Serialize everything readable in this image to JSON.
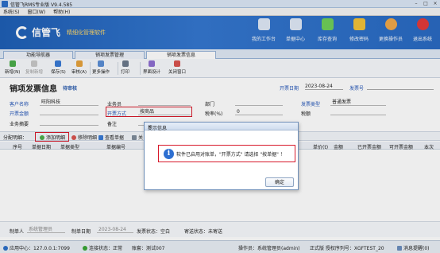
{
  "window": {
    "title": "信管飞RMS专业版 V9.4.585",
    "controls": [
      "–",
      "□",
      "×"
    ]
  },
  "menu": [
    "系统(S)",
    "窗口(W)",
    "帮助(H)"
  ],
  "brand": {
    "name": "信管飞",
    "slogan": "精细化管理软件"
  },
  "nav": [
    {
      "label": "我的工作台",
      "icon": "monitor-icon",
      "color": "#dfe9f7"
    },
    {
      "label": "单据中心",
      "icon": "document-center-icon",
      "color": "#dfe9f7"
    },
    {
      "label": "库存查询",
      "icon": "inventory-icon",
      "color": "#6fcf5a"
    },
    {
      "label": "修改密码",
      "icon": "lock-icon",
      "color": "#f2c23a"
    },
    {
      "label": "更换操作员",
      "icon": "user-icon",
      "color": "#f0a84a"
    },
    {
      "label": "退出系统",
      "icon": "exit-icon",
      "color": "#e23b3b"
    }
  ],
  "tabs": [
    "功能导航器",
    "销项发票管理",
    "销项发票信息"
  ],
  "toolbar": {
    "new": "新增(N)",
    "copy": "复制新增",
    "save": "保存(S)",
    "audit": "审核(A)",
    "more": "更多操作",
    "print": "打印",
    "layout": "界面设计",
    "close": "关闭窗口"
  },
  "form": {
    "title": "销项发票信息",
    "status": "待审核",
    "date_label": "开票日期",
    "date_value": "2023-08-24",
    "invoice_no_label": "发票号",
    "customer_label": "客户名称",
    "customer_value": "旺阳科技",
    "amount_label": "开票金额",
    "salesperson_label": "业务员",
    "method_label": "开票方式",
    "method_value": "按商品",
    "dept_label": "部门",
    "tax_label": "税率(%)",
    "tax_value": "0",
    "invtype_label": "发票类型",
    "invtype_value": "普通发票",
    "taxamt_label": "税额",
    "summary_label": "业务摘要",
    "remark_label": "备注"
  },
  "detail": {
    "label": "分配明细：",
    "add": "添加明细",
    "remove": "移除明细",
    "view": "查看单据",
    "close_btn": "关"
  },
  "grid": {
    "columns": [
      "序号",
      "单据日期",
      "单据类型",
      "单据编号",
      "单价(t)",
      "金额",
      "已开票金额",
      "可开票金额",
      "本次"
    ]
  },
  "footer": {
    "maker_label": "制单人",
    "maker_value": "系统管理员",
    "makedate_label": "制单日期",
    "makedate_value": "2023-08-24",
    "invstatus": "发票状态：空白",
    "mailstatus": "寄送状态：未寄送"
  },
  "statusbar": {
    "center": "应用中心：127.0.0.1:7099",
    "conn": "连接状态：正常",
    "account": "账套：测试007",
    "operator": "操作员：系统管理员(admin)",
    "license": "正式版 授权序列号：XGFTEST_20",
    "message": "消息提醒(0)"
  },
  "dialog": {
    "title": "提示信息",
    "message": "软件已启用对账单，\"开票方式\" 请选择 \"按单据\" ！",
    "ok": "确定"
  },
  "colors": {
    "banner": "#2a6ac2",
    "highlight": "#d8192b",
    "link": "#2355b8"
  }
}
